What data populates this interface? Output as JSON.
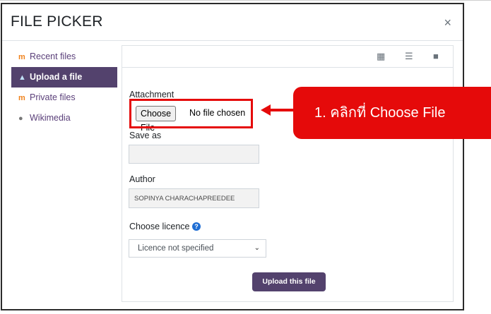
{
  "dialog": {
    "title": "FILE PICKER",
    "close_symbol": "×"
  },
  "sidebar": {
    "items": [
      {
        "label": "Recent files",
        "icon": "moodle-logo-icon"
      },
      {
        "label": "Upload a file",
        "icon": "upload-icon",
        "active": true
      },
      {
        "label": "Private files",
        "icon": "moodle-logo-icon"
      },
      {
        "label": "Wikimedia",
        "icon": "wikimedia-globe-icon"
      }
    ]
  },
  "toolbar": {
    "views": [
      "grid-view-icon",
      "list-view-icon",
      "folder-view-icon"
    ]
  },
  "form": {
    "attachment_label": "Attachment",
    "choose_file_button": "Choose File",
    "no_file_text": "No file chosen",
    "save_as_label": "Save as",
    "save_as_value": "",
    "author_label": "Author",
    "author_value": "SOPINYA CHARACHAPREEDEE",
    "licence_label": "Choose licence",
    "licence_selected": "Licence not specified",
    "upload_button": "Upload this file"
  },
  "annotation": {
    "text": "1. คลิกที่ Choose File",
    "color": "#e50a0a"
  },
  "colors": {
    "brand": "#53426d",
    "highlight": "#e50a0a"
  }
}
